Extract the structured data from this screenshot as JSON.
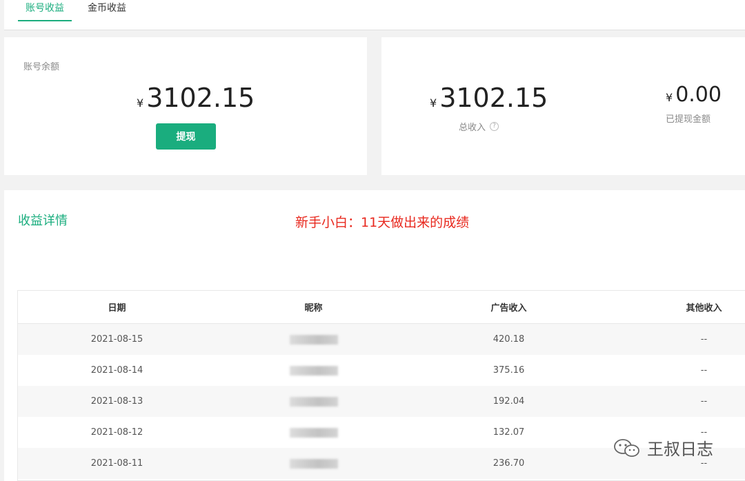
{
  "tabs": [
    {
      "label": "账号收益",
      "active": true
    },
    {
      "label": "金币收益",
      "active": false
    }
  ],
  "balance": {
    "label": "账号余额",
    "currency": "¥",
    "amount": "3102.15",
    "withdraw_label": "提现"
  },
  "income": {
    "currency": "¥",
    "total_amount": "3102.15",
    "total_label": "总收入",
    "withdrawn_amount": "0.00",
    "withdrawn_label": "已提现金额"
  },
  "details": {
    "title": "收益详情",
    "annotation": "新手小白：11天做出来的成绩",
    "columns": [
      "日期",
      "昵称",
      "广告收入",
      "其他收入"
    ],
    "rows": [
      {
        "date": "2021-08-15",
        "ad_income": "420.18",
        "other": "--"
      },
      {
        "date": "2021-08-14",
        "ad_income": "375.16",
        "other": "--"
      },
      {
        "date": "2021-08-13",
        "ad_income": "192.04",
        "other": "--"
      },
      {
        "date": "2021-08-12",
        "ad_income": "132.07",
        "other": "--"
      },
      {
        "date": "2021-08-11",
        "ad_income": "236.70",
        "other": "--"
      }
    ]
  },
  "watermark": {
    "text": "王叔日志"
  },
  "colors": {
    "accent": "#1aad7e",
    "annotation": "#e8281e"
  }
}
